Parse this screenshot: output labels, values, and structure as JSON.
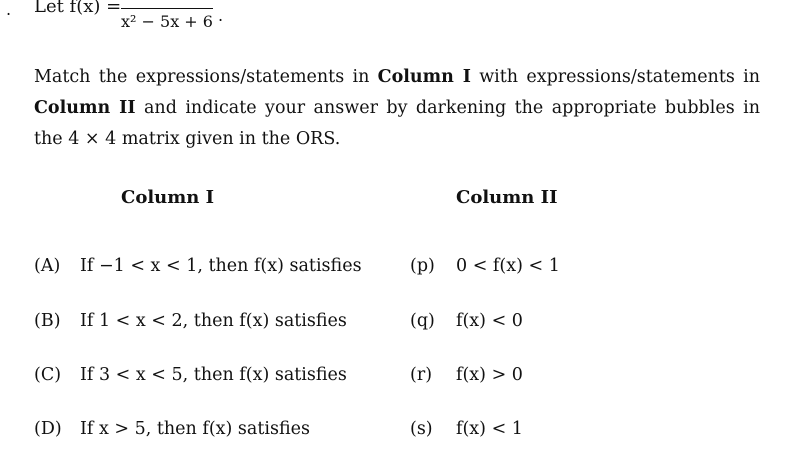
{
  "header": {
    "lead_mark": ".",
    "let_text": "Let f(x) =",
    "denominator": "x² − 5x + 6",
    "period": "."
  },
  "instructions": {
    "part1": "Match the expressions/statements in ",
    "col1": "Column I",
    "part2": " with expressions/statements in ",
    "col2": "Column II",
    "part3": " and indicate your answer by darkening the appropriate bubbles in the 4 × 4 matrix given in the ORS."
  },
  "columns": {
    "col1_title": "Column I",
    "col2_title": "Column II"
  },
  "column_one": [
    {
      "label": "(A)",
      "text": "If −1 < x < 1, then f(x) satisfies"
    },
    {
      "label": "(B)",
      "text": "If 1 < x < 2, then f(x) satisfies"
    },
    {
      "label": "(C)",
      "text": "If 3 < x < 5, then f(x) satisfies"
    },
    {
      "label": "(D)",
      "text": "If x > 5, then f(x) satisfies"
    }
  ],
  "column_two": [
    {
      "label": "(p)",
      "text": "0 < f(x) < 1"
    },
    {
      "label": "(q)",
      "text": "f(x) < 0"
    },
    {
      "label": "(r)",
      "text": "f(x) > 0"
    },
    {
      "label": "(s)",
      "text": "f(x) < 1"
    }
  ]
}
